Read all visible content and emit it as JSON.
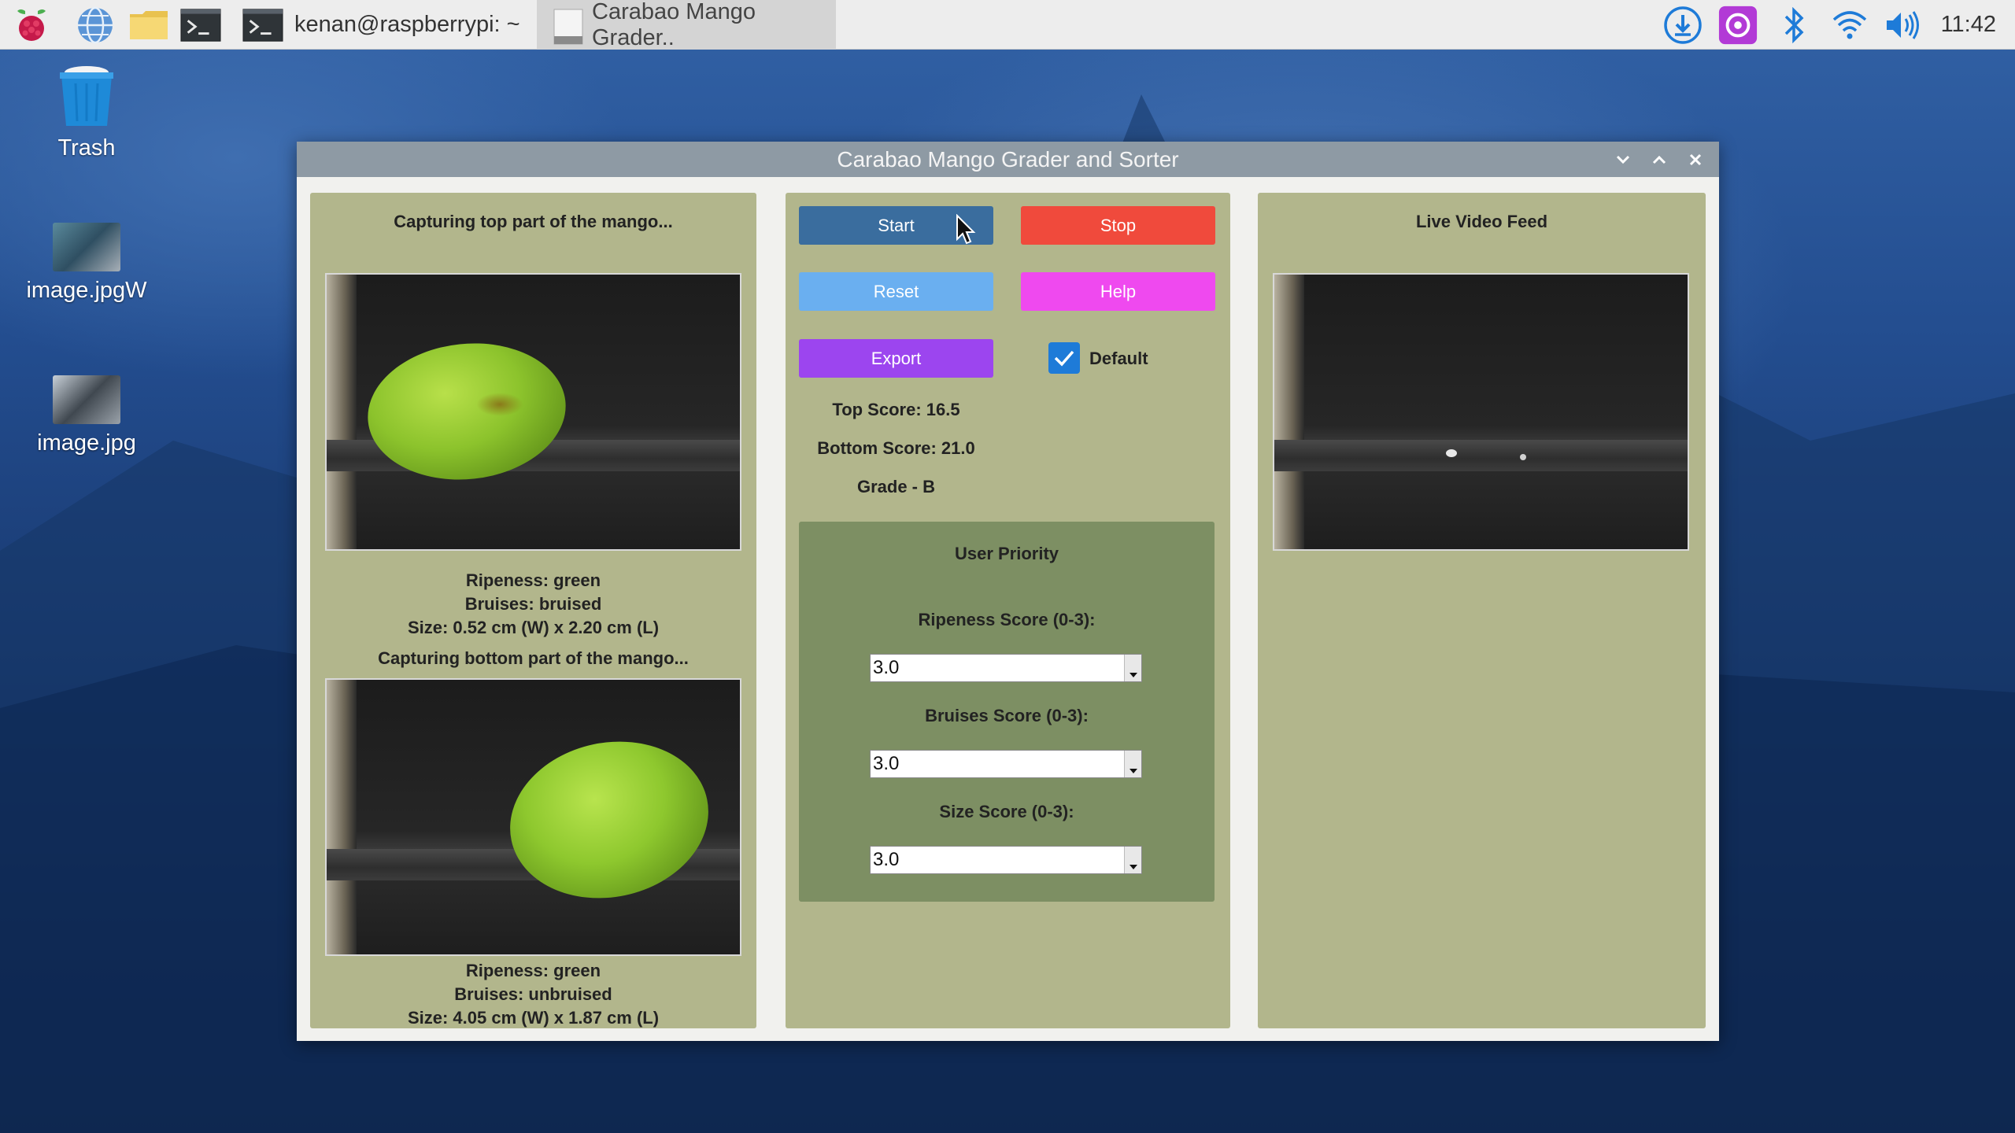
{
  "taskbar": {
    "terminal_title": "kenan@raspberrypi: ~",
    "active_task": "Carabao Mango Grader..",
    "clock": "11:42"
  },
  "desktop": {
    "icons": [
      {
        "label": "Trash"
      },
      {
        "label": "image.jpgW"
      },
      {
        "label": "image.jpg"
      }
    ]
  },
  "window": {
    "title": "Carabao Mango Grader and Sorter",
    "left": {
      "top_status": "Capturing top part of the mango...",
      "top_ripeness": "Ripeness: green",
      "top_bruises": "Bruises: bruised",
      "top_size": "Size: 0.52 cm (W) x 2.20 cm (L)",
      "bottom_status": "Capturing bottom part of the mango...",
      "bottom_ripeness": "Ripeness: green",
      "bottom_bruises": "Bruises: unbruised",
      "bottom_size": "Size: 4.05 cm (W) x 1.87 cm (L)"
    },
    "middle": {
      "start_label": "Start",
      "stop_label": "Stop",
      "reset_label": "Reset",
      "help_label": "Help",
      "export_label": "Export",
      "default_label": "Default",
      "default_checked": true,
      "top_score": "Top Score: 16.5",
      "bottom_score": "Bottom Score: 21.0",
      "grade": "Grade - B",
      "priority": {
        "title": "User Priority",
        "ripeness_label": "Ripeness Score (0-3):",
        "ripeness_value": "3.0",
        "bruises_label": "Bruises Score (0-3):",
        "bruises_value": "3.0",
        "size_label": "Size Score (0-3):",
        "size_value": "3.0"
      }
    },
    "right": {
      "title": "Live Video Feed"
    }
  },
  "colors": {
    "start": "#3a6d9e",
    "stop": "#f04a3c",
    "reset": "#6aaff0",
    "help": "#ef49ef",
    "export": "#9c45ef",
    "panel": "#b2b68c",
    "priority_panel": "#7d8f63"
  }
}
